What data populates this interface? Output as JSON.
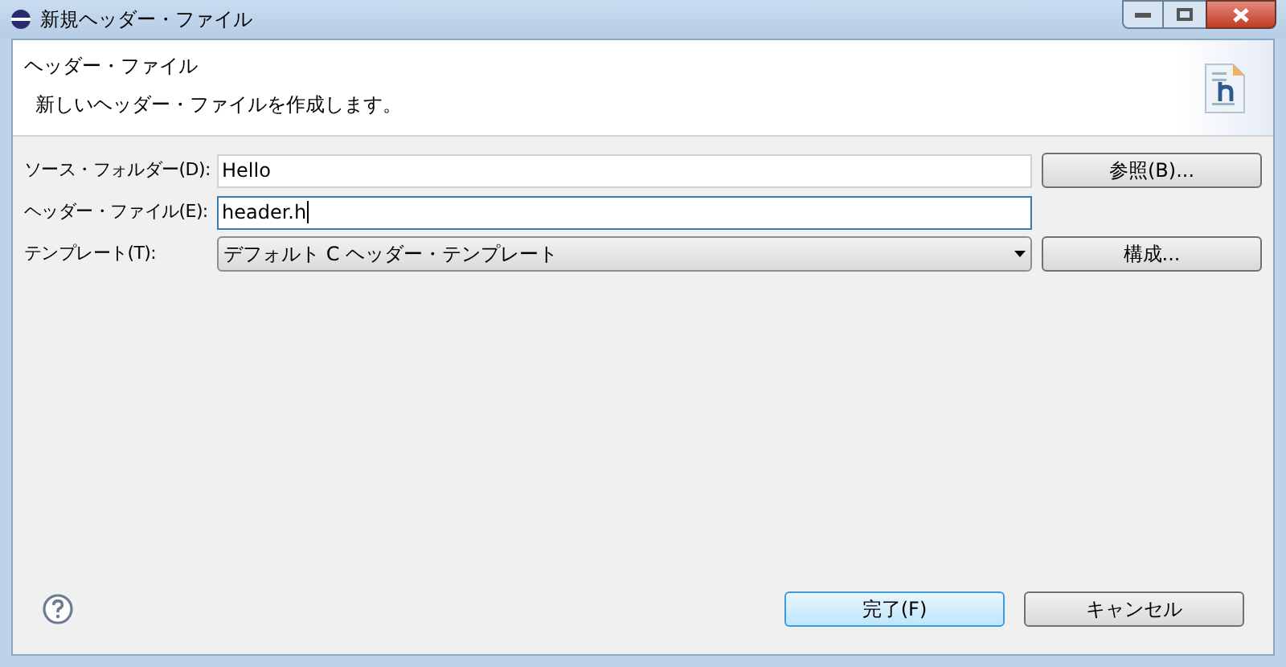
{
  "window": {
    "title": "新規ヘッダー・ファイル"
  },
  "header": {
    "title": "ヘッダー・ファイル",
    "description": "新しいヘッダー・ファイルを作成します。"
  },
  "fields": [
    {
      "kind": "input",
      "label": "ソース・フォルダー(D):",
      "value": "Hello",
      "focused": false,
      "button": "参照(B)..."
    },
    {
      "kind": "input",
      "label": "ヘッダー・ファイル(E):",
      "value": "header.h",
      "focused": true
    },
    {
      "kind": "combo",
      "label": "テンプレート(T):",
      "value": "デフォルト C ヘッダー・テンプレート",
      "button": "構成..."
    }
  ],
  "buttons": [
    {
      "label": "完了(F)",
      "default": true
    },
    {
      "label": "キャンセル",
      "default": false
    }
  ]
}
